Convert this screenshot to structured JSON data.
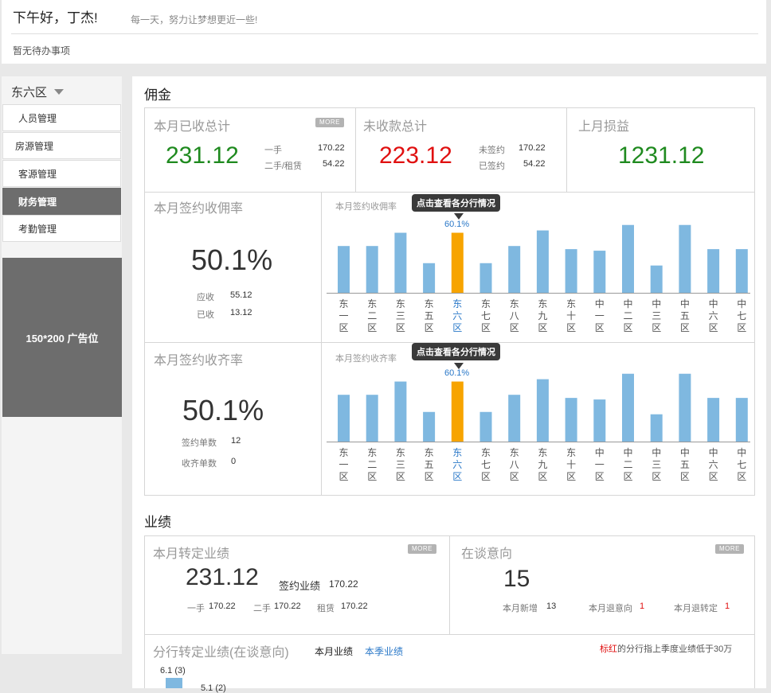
{
  "header": {
    "greeting": "下午好，丁杰!",
    "motto": "每一天，努力让梦想更近一些!",
    "todo": "暂无待办事项"
  },
  "sidebar": {
    "region": "东六区",
    "items": [
      {
        "label": "人员管理"
      },
      {
        "label": "房源管理"
      },
      {
        "label": "客源管理"
      },
      {
        "label": "财务管理",
        "active": true
      },
      {
        "label": "考勤管理"
      }
    ],
    "ad": "150*200 广告位"
  },
  "commission": {
    "section_title": "佣金",
    "more": "MORE",
    "received": {
      "title": "本月已收总计",
      "value": "231.12",
      "rows": [
        {
          "label": "一手",
          "value": "170.22"
        },
        {
          "label": "二手/租赁",
          "value": "54.22"
        }
      ]
    },
    "unreceived": {
      "title": "未收款总计",
      "value": "223.12",
      "rows": [
        {
          "label": "未签约",
          "value": "170.22"
        },
        {
          "label": "已签约",
          "value": "54.22"
        }
      ]
    },
    "last_month": {
      "title": "上月损益",
      "value": "1231.12"
    },
    "rate": {
      "title": "本月签约收佣率",
      "value": "50.1%",
      "rows": [
        {
          "label": "应收",
          "value": "55.12"
        },
        {
          "label": "已收",
          "value": "13.12"
        }
      ]
    },
    "completion": {
      "title": "本月签约收齐率",
      "value": "50.1%",
      "rows": [
        {
          "label": "签约单数",
          "value": "12"
        },
        {
          "label": "收齐单数",
          "value": "0"
        }
      ]
    },
    "tooltip": "点击查看各分行情况"
  },
  "performance": {
    "section_title": "业绩",
    "more": "MORE",
    "transfer": {
      "title": "本月转定业绩",
      "value": "231.12",
      "sign_label": "签约业绩",
      "sign_value": "170.22",
      "rows": [
        {
          "label": "一手",
          "value": "170.22"
        },
        {
          "label": "二手",
          "value": "170.22"
        },
        {
          "label": "租赁",
          "value": "170.22"
        }
      ]
    },
    "intent": {
      "title": "在谈意向",
      "value": "15",
      "rows": [
        {
          "label": "本月新增",
          "value": "13"
        },
        {
          "label": "本月退意向",
          "value": "1"
        },
        {
          "label": "本月退转定",
          "value": "1"
        }
      ]
    },
    "branch": {
      "title": "分行转定业绩(在谈意向)",
      "tab_month": "本月业绩",
      "tab_season": "本季业绩",
      "note_red": "标红",
      "note_rest": "的分行指上季度业绩低于30万",
      "first_bar_label": "6.1 (3)",
      "second_bar_label": "5.1 (2)"
    }
  },
  "chart_data": [
    {
      "type": "bar",
      "title": "本月签约收佣率",
      "categories": [
        "东一区",
        "东二区",
        "东三区",
        "东五区",
        "东六区",
        "东七区",
        "东八区",
        "东九区",
        "东十区",
        "中一区",
        "中二区",
        "中三区",
        "中五区",
        "中六区",
        "中七区"
      ],
      "values": [
        60,
        60,
        77,
        38,
        77,
        38,
        60,
        80,
        56,
        54,
        87,
        35,
        87,
        56,
        56
      ],
      "highlight_index": 4,
      "highlight_label": "60.1%",
      "colors": {
        "bar": "#7fb8e0",
        "highlight": "#f7a400"
      },
      "ylim": [
        0,
        100
      ]
    },
    {
      "type": "bar",
      "title": "本月签约收齐率",
      "categories": [
        "东一区",
        "东二区",
        "东三区",
        "东五区",
        "东六区",
        "东七区",
        "东八区",
        "东九区",
        "东十区",
        "中一区",
        "中二区",
        "中三区",
        "中五区",
        "中六区",
        "中七区"
      ],
      "values": [
        60,
        60,
        77,
        38,
        77,
        38,
        60,
        80,
        56,
        54,
        87,
        35,
        87,
        56,
        56
      ],
      "highlight_index": 4,
      "highlight_label": "60.1%",
      "colors": {
        "bar": "#7fb8e0",
        "highlight": "#f7a400"
      },
      "ylim": [
        0,
        100
      ]
    }
  ]
}
